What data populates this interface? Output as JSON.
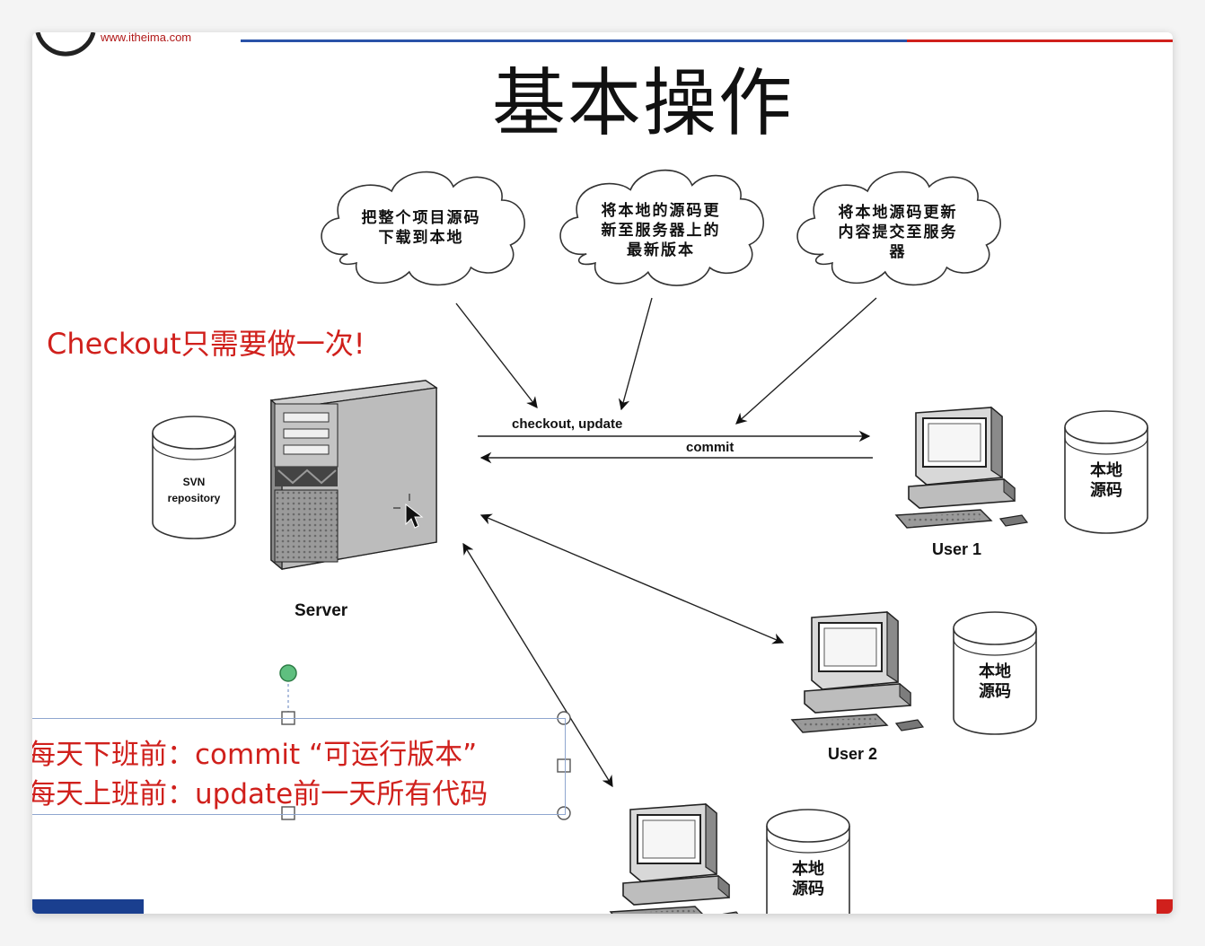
{
  "header": {
    "logo_text": "www.itheima.com"
  },
  "title": "基本操作",
  "clouds": [
    {
      "text": "把整个项目源码\n下载到本地"
    },
    {
      "text": "将本地的源码更\n新至服务器上的\n最新版本"
    },
    {
      "text": "将本地源码更新\n内容提交至服务\n器"
    }
  ],
  "arrow_labels": {
    "checkout_update": "checkout, update",
    "commit": "commit"
  },
  "server": {
    "label": "Server",
    "repo_label_line1": "SVN",
    "repo_label_line2": "repository"
  },
  "users": [
    {
      "label": "User 1",
      "disk_line1": "本地",
      "disk_line2": "源码"
    },
    {
      "label": "User 2",
      "disk_line1": "本地",
      "disk_line2": "源码"
    },
    {
      "label": "",
      "disk_line1": "本地",
      "disk_line2": "源码"
    }
  ],
  "notes": {
    "checkout_once": "Checkout只需要做一次!",
    "daily_commit": "每天下班前：commit “可运行版本”",
    "daily_update": "每天上班前：update前一天所有代码"
  },
  "colors": {
    "accent_red": "#d0201c",
    "footer_blue": "#1a3f8f",
    "header_blue": "#2a52a8",
    "selection_border": "#8fa6cf"
  }
}
